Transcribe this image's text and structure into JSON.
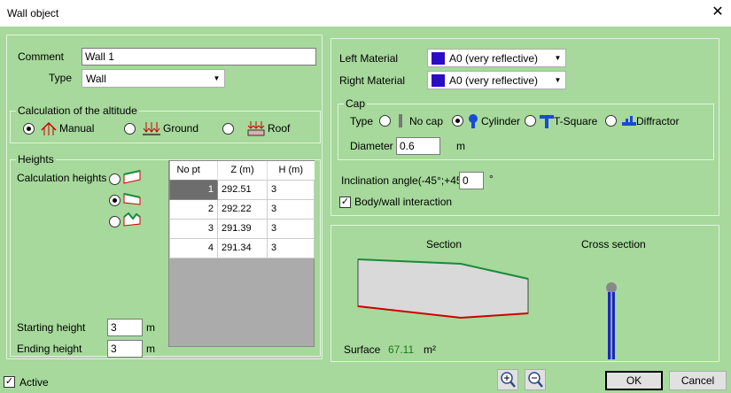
{
  "window": {
    "title": "Wall object"
  },
  "comment": {
    "label": "Comment",
    "value": "Wall 1"
  },
  "type": {
    "label": "Type",
    "value": "Wall"
  },
  "altitude": {
    "title": "Calculation of the altitude",
    "options": [
      {
        "label": "Manual",
        "selected": true
      },
      {
        "label": "Ground",
        "selected": false
      },
      {
        "label": "Roof",
        "selected": false
      }
    ]
  },
  "heights": {
    "title": "Heights",
    "calc_label": "Calculation heights",
    "table": {
      "headers": [
        "No pt",
        "Z (m)",
        "H (m)"
      ],
      "rows": [
        [
          "1",
          "292.51",
          "3"
        ],
        [
          "2",
          "292.22",
          "3"
        ],
        [
          "3",
          "291.39",
          "3"
        ],
        [
          "4",
          "291.34",
          "3"
        ]
      ]
    },
    "starting_label": "Starting height",
    "starting_value": "3",
    "ending_label": "Ending height",
    "ending_value": "3",
    "unit": "m"
  },
  "materials": {
    "left_label": "Left Material",
    "left_value": "A0 (very reflective)",
    "right_label": "Right Material",
    "right_value": "A0 (very reflective)",
    "swatch_color": "#2a0cc7"
  },
  "cap": {
    "title": "Cap",
    "type_label": "Type",
    "options": [
      {
        "label": "No cap",
        "selected": false
      },
      {
        "label": "Cylinder",
        "selected": true
      },
      {
        "label": "T-Square",
        "selected": false
      },
      {
        "label": "Diffractor",
        "selected": false
      }
    ],
    "diameter_label": "Diameter",
    "diameter_value": "0.6",
    "diameter_unit": "m"
  },
  "inclination": {
    "label": "Inclination angle(-45°;+45°)",
    "value": "0",
    "unit": "°"
  },
  "body_wall": {
    "label": "Body/wall interaction",
    "checked": true
  },
  "preview": {
    "section_label": "Section",
    "cross_label": "Cross section",
    "surface_label": "Surface",
    "surface_value": "67.11",
    "surface_unit": "m²"
  },
  "footer": {
    "active_label": "Active",
    "active_checked": true,
    "ok": "OK",
    "cancel": "Cancel"
  },
  "icons": {
    "zoom_in": "zoom-in-icon",
    "zoom_out": "zoom-out-icon"
  },
  "colors": {
    "background": "#a6d99b",
    "material_swatch": "#2a0cc7",
    "surface_value": "#1a7a1a"
  }
}
